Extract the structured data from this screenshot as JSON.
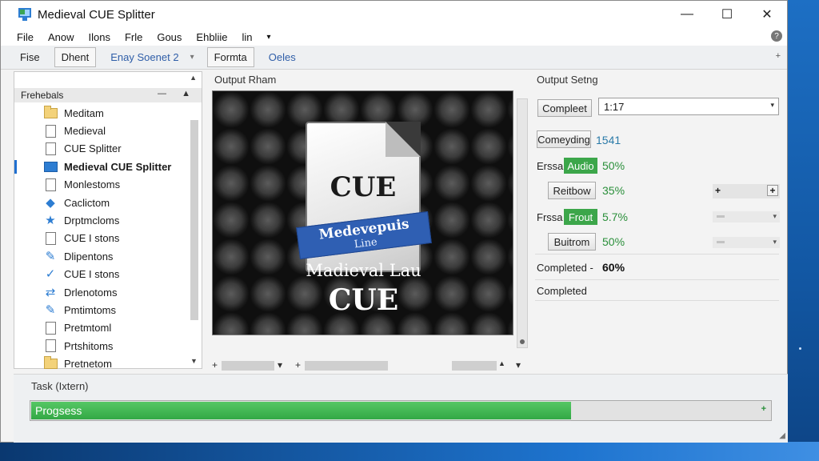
{
  "window": {
    "title": "Medieval CUE Splitter",
    "controls": {
      "minimize": "—",
      "maximize": "☐",
      "close": "✕"
    }
  },
  "menubar": {
    "items": [
      "File",
      "Anow",
      "Ilons",
      "Frle",
      "Gous",
      "Ehbliie",
      "lin"
    ],
    "overflow": "▾",
    "help_icon": "help-circle-icon"
  },
  "toolbar": {
    "items": [
      {
        "label": "Fise",
        "style": "plain"
      },
      {
        "label": "Dhent",
        "style": "pressed"
      },
      {
        "label": "Enay Soenet 2",
        "style": "link"
      }
    ],
    "caret": "▾",
    "items_after": [
      {
        "label": "Formta",
        "style": "pressed"
      },
      {
        "label": "Oeles",
        "style": "link"
      }
    ],
    "plus": "+"
  },
  "sidebar": {
    "header": "Frehebals",
    "header_controls": "— ▲",
    "scroll_up": "▲",
    "scroll_down": "▼",
    "items": [
      {
        "label": "Meditam",
        "icon": "folder-icon",
        "selected": false
      },
      {
        "label": "Medieval",
        "icon": "document-icon",
        "selected": false
      },
      {
        "label": "CUE Splitter",
        "icon": "document-icon",
        "selected": false
      },
      {
        "label": "Medieval CUE Splitter",
        "icon": "window-icon",
        "selected": true
      },
      {
        "label": "Monlestoms",
        "icon": "document-icon",
        "selected": false
      },
      {
        "label": "Caclictom",
        "icon": "tag-icon",
        "selected": false
      },
      {
        "label": "Drptmcloms",
        "icon": "star-icon",
        "selected": false
      },
      {
        "label": "CUE I stons",
        "icon": "list-icon",
        "selected": false
      },
      {
        "label": "Dlipentons",
        "icon": "edit-icon",
        "selected": false
      },
      {
        "label": "CUE I stons",
        "icon": "check-icon",
        "selected": false
      },
      {
        "label": "Drlenotoms",
        "icon": "shuffle-icon",
        "selected": false
      },
      {
        "label": "Pmtimtoms",
        "icon": "edit-icon",
        "selected": false
      },
      {
        "label": "Pretmtoml",
        "icon": "list-icon",
        "selected": false
      },
      {
        "label": "Prtshitoms",
        "icon": "list-icon",
        "selected": false
      },
      {
        "label": "Pretnetom",
        "icon": "folder-icon",
        "selected": false
      }
    ]
  },
  "preview": {
    "label": "Output Rham",
    "art": {
      "doc_text": "CUE",
      "banner_title": "Medevepuis",
      "banner_sub": "Line",
      "caption1": "Madieval Lau",
      "caption2": "CUE"
    }
  },
  "hscrollbar": {
    "left": "+",
    "caret": "▾",
    "plus": "+",
    "up": "▲",
    "down": "▾"
  },
  "settings": {
    "label": "Output Setng",
    "compleet_btn": "Compleet",
    "select_value": "1:17",
    "select_caret": "▾",
    "comm_btn": "Comeyding",
    "comm_value": "1541",
    "row_audio": {
      "label": "Erssa",
      "tag": "Audio",
      "pct": "50%"
    },
    "row_reitbow": {
      "btn": "Reitbow",
      "pct": "35%"
    },
    "row_frout": {
      "label": "Frssa",
      "tag": "Frout",
      "pct": "5.7%"
    },
    "row_buitrom": {
      "btn": "Buitrom",
      "pct": "50%"
    },
    "completed_line": {
      "label": "Completed -",
      "pct": "60%"
    },
    "completed_status": "Completed",
    "stepper_minus": "+",
    "stepper_plus": "+",
    "dropdown_caret": "▾"
  },
  "task": {
    "label": "Task (Ixtern)",
    "progress_label": "Progsess",
    "progress_value": 0.73,
    "progress_plus": "+",
    "grip": "◢"
  },
  "colors": {
    "accent_green": "#3ca64a",
    "link_blue": "#2f5ea8",
    "selection_blue": "#1f6fd0"
  }
}
